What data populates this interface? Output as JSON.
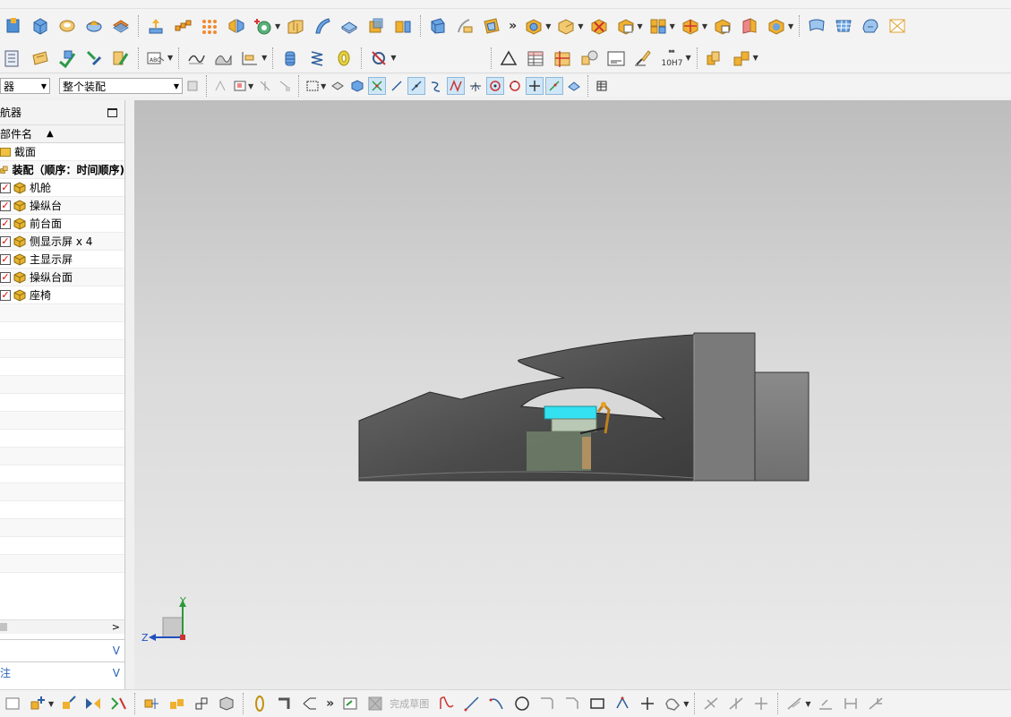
{
  "toolbar": {
    "row3": {
      "filter_select": "器",
      "scope_select": "整个装配",
      "tolerance_label": "10H7"
    },
    "overflow_glyph": "»"
  },
  "navigator": {
    "title": "航器",
    "column_header": "部件名",
    "sort_glyph": "▲",
    "items": [
      {
        "label": "截面",
        "type": "folder"
      },
      {
        "label": "装配（顺序：时间顺序)",
        "type": "assembly"
      },
      {
        "label": "机舱",
        "checked": true
      },
      {
        "label": "操纵台",
        "checked": true
      },
      {
        "label": "前台面",
        "checked": true
      },
      {
        "label": "侧显示屏 x 4",
        "checked": true
      },
      {
        "label": "主显示屏",
        "checked": true
      },
      {
        "label": "操纵台面",
        "checked": true
      },
      {
        "label": "座椅",
        "checked": true
      }
    ],
    "scroll_right_glyph": ">",
    "panel2_glyph": "V",
    "panel3_label": "注",
    "panel3_glyph": "V"
  },
  "viewport": {
    "axis_y": "Y",
    "axis_z": "Z"
  },
  "bottom_toolbar": {
    "finish_sketch_label": "完成草图",
    "overflow_glyph": "»"
  },
  "colors": {
    "accent": "#2a63b8",
    "check": "#d00000",
    "cube": "#e8b430",
    "body_dark": "#555555",
    "screen": "#33e1f0"
  }
}
